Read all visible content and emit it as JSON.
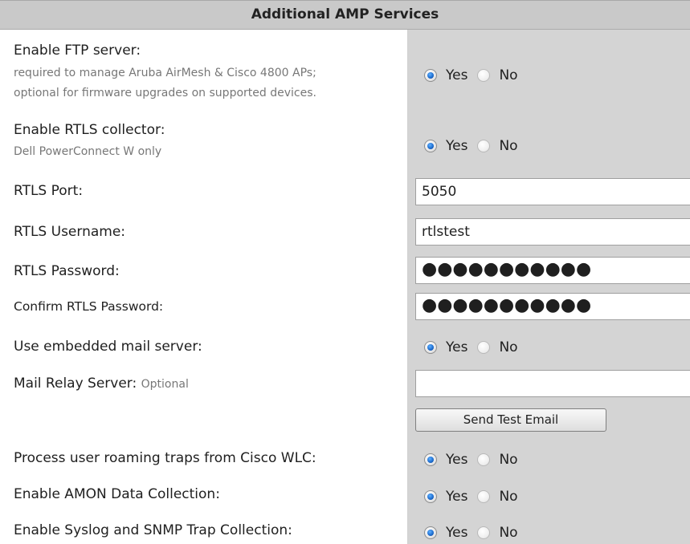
{
  "header": {
    "title": "Additional AMP Services"
  },
  "rows": {
    "ftp": {
      "label": "Enable FTP server:",
      "sub1": "required to manage Aruba AirMesh & Cisco 4800 APs;",
      "sub2": "optional for firmware upgrades on supported devices.",
      "yes": "Yes",
      "no": "No",
      "selected": "Yes"
    },
    "rtls": {
      "label": "Enable RTLS collector:",
      "sub": "Dell PowerConnect W only",
      "yes": "Yes",
      "no": "No",
      "selected": "Yes"
    },
    "rtls_port": {
      "label": "RTLS Port:",
      "value": "5050"
    },
    "rtls_username": {
      "label": "RTLS Username:",
      "value": "rtlstest"
    },
    "rtls_password": {
      "label": "RTLS Password:",
      "value": "●●●●●●●●●●●"
    },
    "rtls_confirm": {
      "label": "Confirm RTLS Password:",
      "value": "●●●●●●●●●●●"
    },
    "mail_server": {
      "label": "Use embedded mail server:",
      "yes": "Yes",
      "no": "No",
      "selected": "Yes"
    },
    "mail_relay": {
      "label": "Mail Relay Server:",
      "optional": "Optional",
      "value": ""
    },
    "send_test": {
      "label": "Send Test Email"
    },
    "roaming": {
      "label": "Process user roaming traps from Cisco WLC:",
      "yes": "Yes",
      "no": "No",
      "selected": "Yes"
    },
    "amon": {
      "label": "Enable AMON Data Collection:",
      "yes": "Yes",
      "no": "No",
      "selected": "Yes"
    },
    "syslog": {
      "label": "Enable Syslog and SNMP Trap Collection:",
      "yes": "Yes",
      "no": "No",
      "selected": "Yes"
    }
  },
  "colors": {
    "header_bg": "#c9c9c9",
    "right_col_bg": "#d4d4d4",
    "radio_selected": "#1f6fd1"
  }
}
